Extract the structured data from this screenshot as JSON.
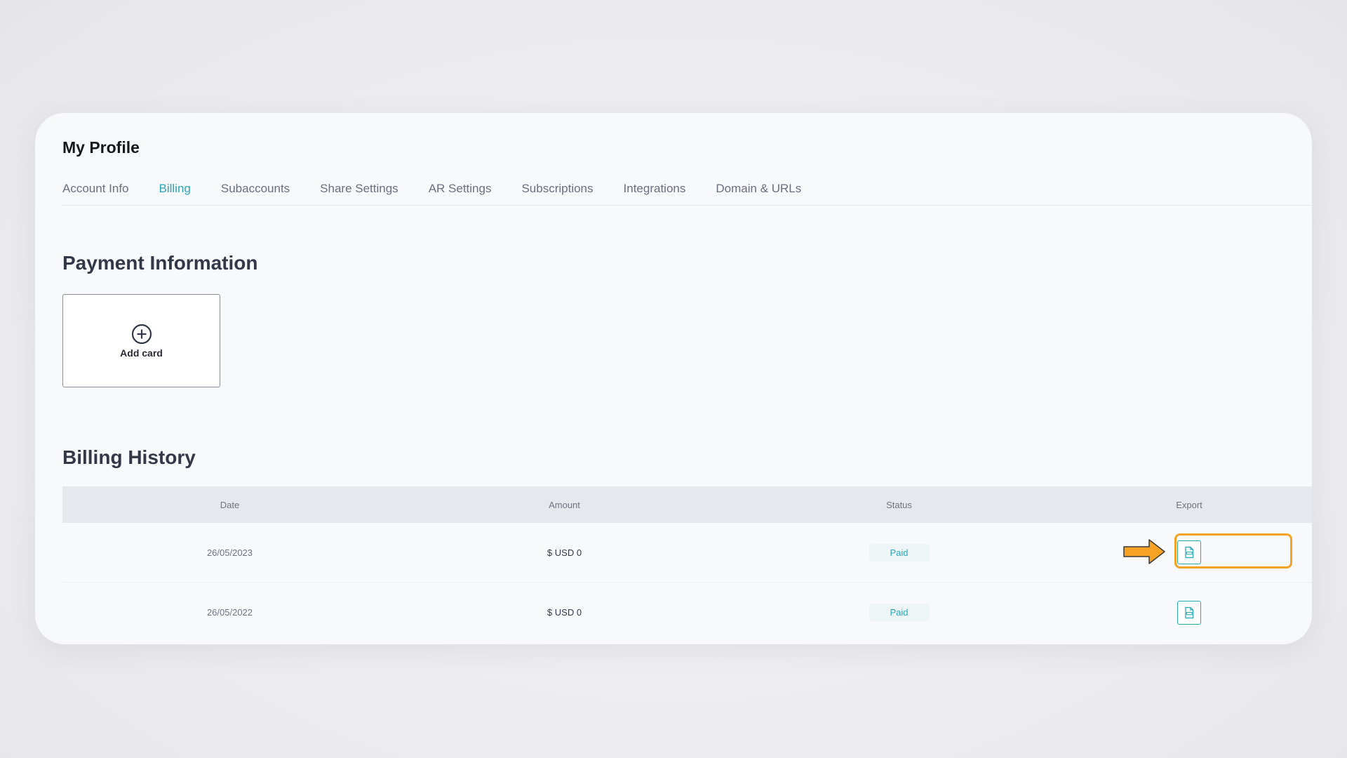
{
  "page": {
    "title": "My Profile"
  },
  "tabs": [
    {
      "label": "Account Info",
      "active": false
    },
    {
      "label": "Billing",
      "active": true
    },
    {
      "label": "Subaccounts",
      "active": false
    },
    {
      "label": "Share Settings",
      "active": false
    },
    {
      "label": "AR Settings",
      "active": false
    },
    {
      "label": "Subscriptions",
      "active": false
    },
    {
      "label": "Integrations",
      "active": false
    },
    {
      "label": "Domain & URLs",
      "active": false
    }
  ],
  "payment": {
    "title": "Payment Information",
    "add_card_label": "Add card",
    "add_card_icon": "plus-circle-icon"
  },
  "billing": {
    "title": "Billing History",
    "columns": [
      "Date",
      "Amount",
      "Status",
      "Export"
    ],
    "rows": [
      {
        "date": "26/05/2023",
        "amount": "$ USD 0",
        "status": "Paid",
        "export_icon": "pdf-file-icon",
        "highlighted": true
      },
      {
        "date": "26/05/2022",
        "amount": "$ USD 0",
        "status": "Paid",
        "export_icon": "pdf-file-icon",
        "highlighted": false
      }
    ]
  },
  "colors": {
    "accent": "#2aa7b7",
    "highlight": "#f5a225",
    "heading": "#323847"
  }
}
